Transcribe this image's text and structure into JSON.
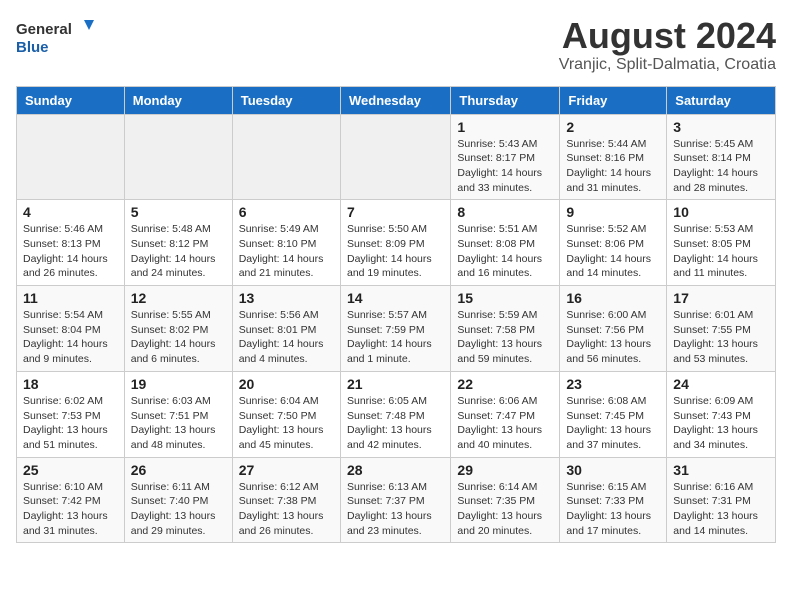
{
  "header": {
    "logo_general": "General",
    "logo_blue": "Blue",
    "month_year": "August 2024",
    "location": "Vranjic, Split-Dalmatia, Croatia"
  },
  "weekdays": [
    "Sunday",
    "Monday",
    "Tuesday",
    "Wednesday",
    "Thursday",
    "Friday",
    "Saturday"
  ],
  "weeks": [
    [
      {
        "day": "",
        "detail": ""
      },
      {
        "day": "",
        "detail": ""
      },
      {
        "day": "",
        "detail": ""
      },
      {
        "day": "",
        "detail": ""
      },
      {
        "day": "1",
        "detail": "Sunrise: 5:43 AM\nSunset: 8:17 PM\nDaylight: 14 hours\nand 33 minutes."
      },
      {
        "day": "2",
        "detail": "Sunrise: 5:44 AM\nSunset: 8:16 PM\nDaylight: 14 hours\nand 31 minutes."
      },
      {
        "day": "3",
        "detail": "Sunrise: 5:45 AM\nSunset: 8:14 PM\nDaylight: 14 hours\nand 28 minutes."
      }
    ],
    [
      {
        "day": "4",
        "detail": "Sunrise: 5:46 AM\nSunset: 8:13 PM\nDaylight: 14 hours\nand 26 minutes."
      },
      {
        "day": "5",
        "detail": "Sunrise: 5:48 AM\nSunset: 8:12 PM\nDaylight: 14 hours\nand 24 minutes."
      },
      {
        "day": "6",
        "detail": "Sunrise: 5:49 AM\nSunset: 8:10 PM\nDaylight: 14 hours\nand 21 minutes."
      },
      {
        "day": "7",
        "detail": "Sunrise: 5:50 AM\nSunset: 8:09 PM\nDaylight: 14 hours\nand 19 minutes."
      },
      {
        "day": "8",
        "detail": "Sunrise: 5:51 AM\nSunset: 8:08 PM\nDaylight: 14 hours\nand 16 minutes."
      },
      {
        "day": "9",
        "detail": "Sunrise: 5:52 AM\nSunset: 8:06 PM\nDaylight: 14 hours\nand 14 minutes."
      },
      {
        "day": "10",
        "detail": "Sunrise: 5:53 AM\nSunset: 8:05 PM\nDaylight: 14 hours\nand 11 minutes."
      }
    ],
    [
      {
        "day": "11",
        "detail": "Sunrise: 5:54 AM\nSunset: 8:04 PM\nDaylight: 14 hours\nand 9 minutes."
      },
      {
        "day": "12",
        "detail": "Sunrise: 5:55 AM\nSunset: 8:02 PM\nDaylight: 14 hours\nand 6 minutes."
      },
      {
        "day": "13",
        "detail": "Sunrise: 5:56 AM\nSunset: 8:01 PM\nDaylight: 14 hours\nand 4 minutes."
      },
      {
        "day": "14",
        "detail": "Sunrise: 5:57 AM\nSunset: 7:59 PM\nDaylight: 14 hours\nand 1 minute."
      },
      {
        "day": "15",
        "detail": "Sunrise: 5:59 AM\nSunset: 7:58 PM\nDaylight: 13 hours\nand 59 minutes."
      },
      {
        "day": "16",
        "detail": "Sunrise: 6:00 AM\nSunset: 7:56 PM\nDaylight: 13 hours\nand 56 minutes."
      },
      {
        "day": "17",
        "detail": "Sunrise: 6:01 AM\nSunset: 7:55 PM\nDaylight: 13 hours\nand 53 minutes."
      }
    ],
    [
      {
        "day": "18",
        "detail": "Sunrise: 6:02 AM\nSunset: 7:53 PM\nDaylight: 13 hours\nand 51 minutes."
      },
      {
        "day": "19",
        "detail": "Sunrise: 6:03 AM\nSunset: 7:51 PM\nDaylight: 13 hours\nand 48 minutes."
      },
      {
        "day": "20",
        "detail": "Sunrise: 6:04 AM\nSunset: 7:50 PM\nDaylight: 13 hours\nand 45 minutes."
      },
      {
        "day": "21",
        "detail": "Sunrise: 6:05 AM\nSunset: 7:48 PM\nDaylight: 13 hours\nand 42 minutes."
      },
      {
        "day": "22",
        "detail": "Sunrise: 6:06 AM\nSunset: 7:47 PM\nDaylight: 13 hours\nand 40 minutes."
      },
      {
        "day": "23",
        "detail": "Sunrise: 6:08 AM\nSunset: 7:45 PM\nDaylight: 13 hours\nand 37 minutes."
      },
      {
        "day": "24",
        "detail": "Sunrise: 6:09 AM\nSunset: 7:43 PM\nDaylight: 13 hours\nand 34 minutes."
      }
    ],
    [
      {
        "day": "25",
        "detail": "Sunrise: 6:10 AM\nSunset: 7:42 PM\nDaylight: 13 hours\nand 31 minutes."
      },
      {
        "day": "26",
        "detail": "Sunrise: 6:11 AM\nSunset: 7:40 PM\nDaylight: 13 hours\nand 29 minutes."
      },
      {
        "day": "27",
        "detail": "Sunrise: 6:12 AM\nSunset: 7:38 PM\nDaylight: 13 hours\nand 26 minutes."
      },
      {
        "day": "28",
        "detail": "Sunrise: 6:13 AM\nSunset: 7:37 PM\nDaylight: 13 hours\nand 23 minutes."
      },
      {
        "day": "29",
        "detail": "Sunrise: 6:14 AM\nSunset: 7:35 PM\nDaylight: 13 hours\nand 20 minutes."
      },
      {
        "day": "30",
        "detail": "Sunrise: 6:15 AM\nSunset: 7:33 PM\nDaylight: 13 hours\nand 17 minutes."
      },
      {
        "day": "31",
        "detail": "Sunrise: 6:16 AM\nSunset: 7:31 PM\nDaylight: 13 hours\nand 14 minutes."
      }
    ]
  ]
}
